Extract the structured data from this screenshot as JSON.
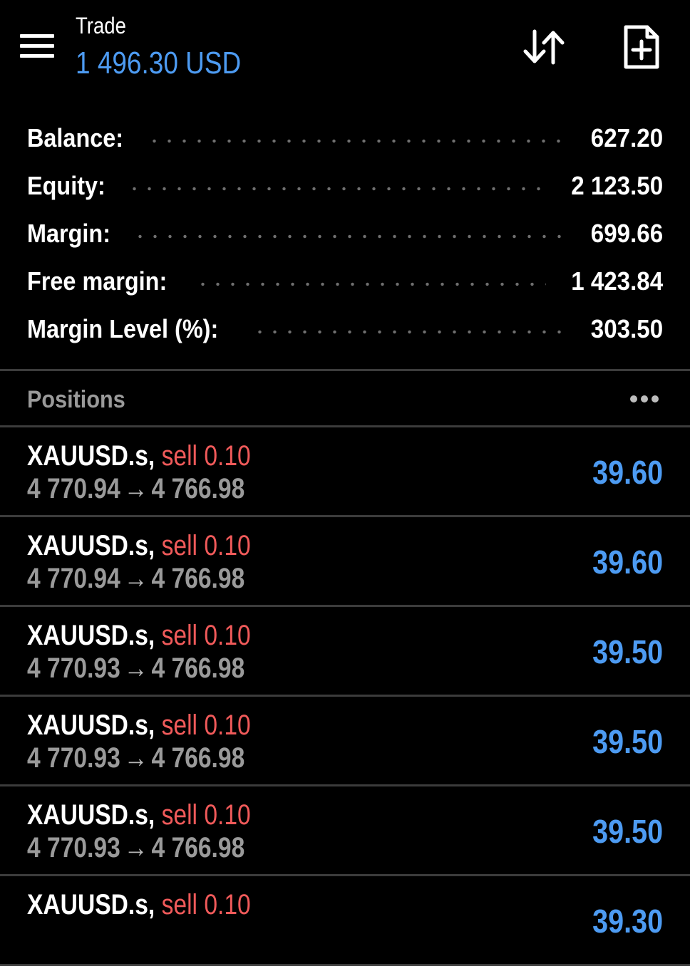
{
  "header": {
    "title": "Trade",
    "value": "1 496.30 USD",
    "icons": {
      "menu": "hamburger-menu-icon",
      "sort": "sort-arrows-icon",
      "new_order": "new-order-document-plus-icon"
    }
  },
  "summary": [
    {
      "label": "Balance:",
      "value": "627.20"
    },
    {
      "label": "Equity:",
      "value": "2 123.50"
    },
    {
      "label": "Margin:",
      "value": "699.66"
    },
    {
      "label": "Free margin:",
      "value": "1 423.84"
    },
    {
      "label": "Margin Level (%):",
      "value": "303.50"
    }
  ],
  "positions": {
    "title": "Positions",
    "more_icon": "more-dots-icon",
    "items": [
      {
        "symbol": "XAUUSD.s,",
        "side": "sell 0.10",
        "open": "4 770.94",
        "arrow": "→",
        "current": "4 766.98",
        "profit": "39.60"
      },
      {
        "symbol": "XAUUSD.s,",
        "side": "sell 0.10",
        "open": "4 770.94",
        "arrow": "→",
        "current": "4 766.98",
        "profit": "39.60"
      },
      {
        "symbol": "XAUUSD.s,",
        "side": "sell 0.10",
        "open": "4 770.93",
        "arrow": "→",
        "current": "4 766.98",
        "profit": "39.50"
      },
      {
        "symbol": "XAUUSD.s,",
        "side": "sell 0.10",
        "open": "4 770.93",
        "arrow": "→",
        "current": "4 766.98",
        "profit": "39.50"
      },
      {
        "symbol": "XAUUSD.s,",
        "side": "sell 0.10",
        "open": "4 770.93",
        "arrow": "→",
        "current": "4 766.98",
        "profit": "39.50"
      },
      {
        "symbol": "XAUUSD.s,",
        "side": "sell 0.10",
        "open": "",
        "arrow": "",
        "current": "",
        "profit": "39.30"
      }
    ]
  },
  "colors": {
    "background": "#000000",
    "accent_blue": "#4d9bf2",
    "sell_red": "#f05a5a",
    "muted_gray": "#9a9a9a",
    "divider": "#3c3c3c"
  }
}
